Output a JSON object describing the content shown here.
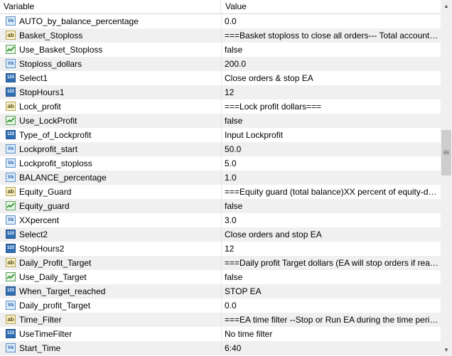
{
  "columns": {
    "variable": "Variable",
    "value": "Value"
  },
  "rows": [
    {
      "type": "dbl",
      "name": "AUTO_by_balance_percentage",
      "value": "0.0"
    },
    {
      "type": "str",
      "name": "Basket_Stoploss",
      "value": "===Basket stoploss to close all orders--- Total account loss re..."
    },
    {
      "type": "bool",
      "name": "Use_Basket_Stoploss",
      "value": "false"
    },
    {
      "type": "dbl",
      "name": "Stoploss_dollars",
      "value": "200.0"
    },
    {
      "type": "num",
      "name": "Select1",
      "value": "Close orders & stop EA"
    },
    {
      "type": "num",
      "name": "StopHours1",
      "value": "12"
    },
    {
      "type": "str",
      "name": "Lock_profit",
      "value": "===Lock profit dollars==="
    },
    {
      "type": "bool",
      "name": "Use_LockProfit",
      "value": "false"
    },
    {
      "type": "num",
      "name": "Type_of_Lockprofit",
      "value": "Input Lockprofit"
    },
    {
      "type": "dbl",
      "name": "Lockprofit_start",
      "value": "50.0"
    },
    {
      "type": "dbl",
      "name": "Lockprofit_stoploss",
      "value": "5.0"
    },
    {
      "type": "dbl",
      "name": "BALANCE_percentage",
      "value": "1.0"
    },
    {
      "type": "str",
      "name": "Equity_Guard",
      "value": "===Equity guard (total balance)XX percent of equity-drawndo..."
    },
    {
      "type": "bool",
      "name": "Equity_guard",
      "value": "false"
    },
    {
      "type": "dbl",
      "name": "XXpercent",
      "value": "3.0"
    },
    {
      "type": "num",
      "name": "Select2",
      "value": "Close orders and stop EA"
    },
    {
      "type": "num",
      "name": "StopHours2",
      "value": "12"
    },
    {
      "type": "str",
      "name": "Daily_Profit_Target",
      "value": "===Daily profit Target dollars (EA will stop orders if reach to th..."
    },
    {
      "type": "bool",
      "name": "Use_Daily_Target",
      "value": "false"
    },
    {
      "type": "num",
      "name": "When_Target_reached",
      "value": "STOP EA"
    },
    {
      "type": "dbl",
      "name": "Daily_profit_Target",
      "value": "0.0"
    },
    {
      "type": "str",
      "name": "Time_Filter",
      "value": "===EA time filter --Stop or Run EA during the time period(hour..."
    },
    {
      "type": "num",
      "name": "UseTimeFilter",
      "value": "No time filter"
    },
    {
      "type": "dbl",
      "name": "Start_Time",
      "value": "6:40"
    }
  ]
}
